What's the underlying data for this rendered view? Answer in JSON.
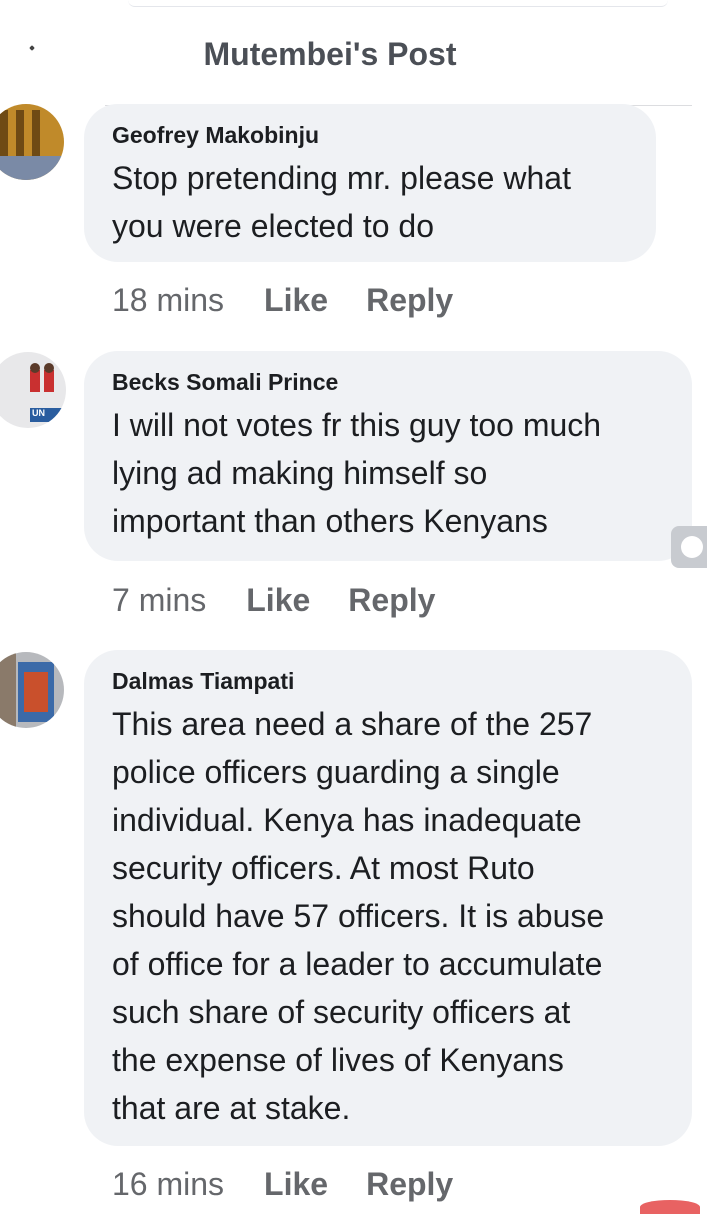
{
  "header": {
    "title": "Mutembei's Post"
  },
  "comments": [
    {
      "author": "Geofrey Makobinju",
      "lines": [
        "Stop pretending mr. please what",
        "you were elected to do"
      ],
      "time": "18 mins",
      "like": "Like",
      "reply": "Reply"
    },
    {
      "author": "Becks Somali Prince",
      "lines": [
        "I will not votes fr this guy too much",
        "lying ad making himself so",
        "important than others Kenyans"
      ],
      "time": "7 mins",
      "like": "Like",
      "reply": "Reply"
    },
    {
      "author": "Dalmas Tiampati",
      "lines": [
        "This area need a share of the 257",
        "police officers guarding a single",
        "individual. Kenya has inadequate",
        "security officers. At most Ruto",
        "should have 57 officers. It is abuse",
        "of office for a leader to accumulate",
        "such share of security officers at",
        "the expense of lives of Kenyans",
        "that are at stake."
      ],
      "time": "16 mins",
      "like": "Like",
      "reply": "Reply"
    }
  ],
  "avatar_badge_text": "UN"
}
